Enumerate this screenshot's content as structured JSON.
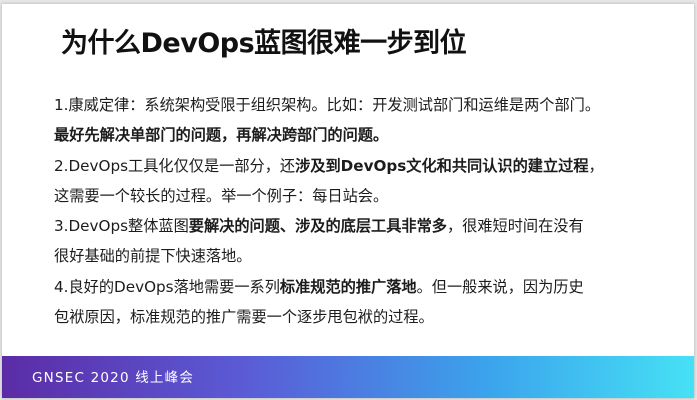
{
  "slide": {
    "title": "为什么DevOps蓝图很难一步到位",
    "lines": [
      [
        {
          "text": "1.康威定律：系统架构受限于组织架构。比如：开发测试部门和运维是两个部门。",
          "bold": false
        }
      ],
      [
        {
          "text": "最好先解决单部门的问题，再解决跨部门的问题。",
          "bold": true
        }
      ],
      [
        {
          "text": "2.DevOps工具化仅仅是一部分，还",
          "bold": false
        },
        {
          "text": "涉及到DevOps文化和共同认识的建立过程",
          "bold": true
        },
        {
          "text": "，",
          "bold": false
        }
      ],
      [
        {
          "text": "这需要一个较长的过程。举一个例子：每日站会。",
          "bold": false
        }
      ],
      [
        {
          "text": "3.DevOps整体蓝图",
          "bold": false
        },
        {
          "text": "要解决的问题、涉及的底层工具非常多",
          "bold": true
        },
        {
          "text": "，很难短时间在没有",
          "bold": false
        }
      ],
      [
        {
          "text": "很好基础的前提下快速落地。",
          "bold": false
        }
      ],
      [
        {
          "text": "4.良好的DevOps落地需要一系列",
          "bold": false
        },
        {
          "text": "标准规范的推广落地",
          "bold": true
        },
        {
          "text": "。但一般来说，因为历史",
          "bold": false
        }
      ],
      [
        {
          "text": "包袱原因，标准规范的推广需要一个逐步甩包袱的过程。",
          "bold": false
        }
      ]
    ]
  },
  "footer": {
    "text": "GNSEC 2020 线上峰会"
  },
  "colors": {
    "footer_gradient_start": "#5b2ca6",
    "footer_gradient_end": "#46e1f5",
    "title": "#111111",
    "body_text": "#1c1c1c"
  }
}
